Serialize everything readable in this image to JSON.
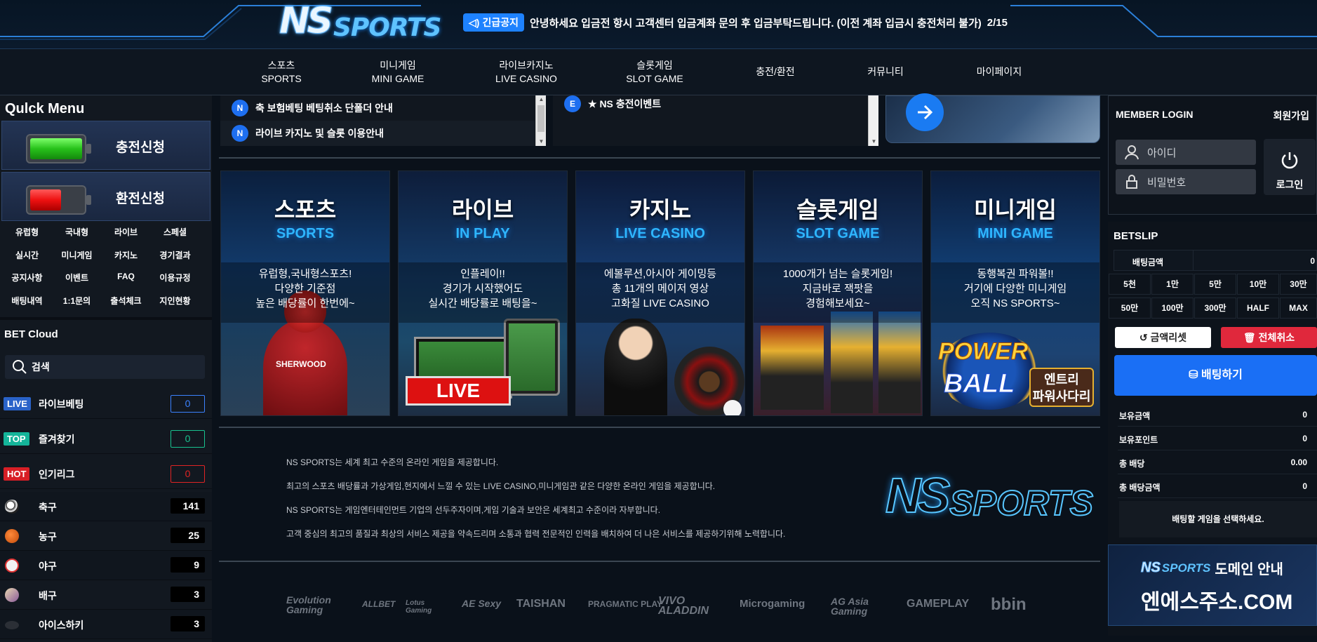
{
  "header": {
    "logo_ns": "NS",
    "logo_sports": "SPORTS",
    "notice_badge": "긴급공지",
    "notice_text": "안녕하세요 입금전 항시 고객센터 입금계좌 문의 후 입금부탁드립니다. (이전 계좌 입금시 충전처리 불가)",
    "notice_page": "2/15"
  },
  "nav": [
    {
      "kr": "스포츠",
      "en": "SPORTS"
    },
    {
      "kr": "미니게임",
      "en": "MINI GAME"
    },
    {
      "kr": "라이브카지노",
      "en": "LIVE CASINO"
    },
    {
      "kr": "슬롯게임",
      "en": "SLOT GAME"
    },
    {
      "kr": "충전/환전",
      "en": ""
    },
    {
      "kr": "커뮤니티",
      "en": ""
    },
    {
      "kr": "마이페이지",
      "en": ""
    }
  ],
  "quick_menu": {
    "title": "Qulck Menu",
    "charge": "충전신청",
    "exchange": "환전신청",
    "links": [
      "유럽형",
      "국내형",
      "라이브",
      "스페셜",
      "실시간",
      "미니게임",
      "카지노",
      "경기결과",
      "공지사항",
      "이벤트",
      "FAQ",
      "이용규정",
      "배팅내역",
      "1:1문의",
      "출석체크",
      "지인현황"
    ]
  },
  "bet_cloud": {
    "title": "BET Cloud",
    "search_placeholder": "검색",
    "tags": [
      {
        "tag": "LIVE",
        "label": "라이브베팅",
        "count": "0",
        "color": "#2a63c9",
        "count_color": "#3b82ff"
      },
      {
        "tag": "TOP",
        "label": "즐겨찾기",
        "count": "0",
        "color": "#15b59a",
        "count_color": "#19c28f"
      },
      {
        "tag": "HOT",
        "label": "인기리그",
        "count": "0",
        "color": "#d81f26",
        "count_color": "#e02424"
      }
    ],
    "sports": [
      {
        "name": "축구",
        "count": "141",
        "icon": "soccer-ball-icon"
      },
      {
        "name": "농구",
        "count": "25",
        "icon": "basketball-icon"
      },
      {
        "name": "야구",
        "count": "9",
        "icon": "baseball-icon"
      },
      {
        "name": "배구",
        "count": "3",
        "icon": "volleyball-icon"
      },
      {
        "name": "아이스하키",
        "count": "3",
        "icon": "hockey-puck-icon"
      }
    ]
  },
  "notices_left": [
    {
      "badge": "N",
      "text": "축 보험베팅 베팅취소 단폴더 안내"
    },
    {
      "badge": "N",
      "text": "라이브 카지노 및 슬롯 이용안내"
    }
  ],
  "notices_right": [
    {
      "badge": "E",
      "text": "★ NS 충전이벤트"
    }
  ],
  "cards": [
    {
      "kr": "스포츠",
      "en": "SPORTS",
      "desc": [
        "유럽형,국내형스포츠!",
        "다양한 기준점",
        "높은 배당률이 한번에~"
      ]
    },
    {
      "kr": "라이브",
      "en": "IN PLAY",
      "desc": [
        "인플레이!!",
        "경기가 시작했어도",
        "실시간 배당률로 배팅을~"
      ]
    },
    {
      "kr": "카지노",
      "en": "LIVE CASINO",
      "desc": [
        "에볼루션,아시아 게이밍등",
        "총 11개의 메이저 영상",
        "고화질 LIVE CASINO"
      ]
    },
    {
      "kr": "슬롯게임",
      "en": "SLOT GAME",
      "desc": [
        "1000개가 넘는 슬롯게임!",
        "지금바로 잭팟을",
        "경험해보세요~"
      ]
    },
    {
      "kr": "미니게임",
      "en": "MINI GAME",
      "desc": [
        "동행복권 파워볼!!",
        "거기에 다양한 미니게임",
        "오직 NS SPORTS~"
      ]
    }
  ],
  "card_extras": {
    "live_badge": "LIVE",
    "powerball_1": "POWER",
    "powerball_2": "BALL",
    "entry_1": "엔트리",
    "entry_2": "파워사다리",
    "jersey_text": "SHERWOOD"
  },
  "footer": {
    "lines": [
      "NS SPORTS는 세계 최고 수준의 온라인 게임을 제공합니다.",
      "최고의 스포츠 배당률과 가상게임,현지에서 느낄 수 있는 LIVE CASINO,미니게임관 같은 다양한 온라인 게임을 제공합니다.",
      "NS SPORTS는 게임엔터테인먼트 기업의 선두주자이며,게임 기술과 보안은 세계최고 수준이라 자부합니다.",
      "고객 중심의 최고의 품질과 최상의 서비스 제공을 약속드리며 소통과 협력 전문적인 인력을 배치하여 더 나은 서비스를 제공하기위해 노력합니다."
    ],
    "providers": [
      "Evolution Gaming",
      "ALLBET",
      "Lotus Gaming",
      "AE Sexy",
      "TAISHAN",
      "PRAGMATIC PLAY",
      "VIVO ALADDIN",
      "Microgaming",
      "AG Asia Gaming",
      "GAMEPLAY",
      "bbin"
    ]
  },
  "member": {
    "title": "MEMBER LOGIN",
    "join": "회원가입",
    "id_placeholder": "아이디",
    "pw_placeholder": "비밀번호",
    "login": "로그인"
  },
  "betslip": {
    "title": "BETSLIP",
    "amount_label": "배팅금액",
    "amount_value": "0",
    "chips_row1": [
      "5천",
      "1만",
      "5만",
      "10만",
      "30만"
    ],
    "chips_row2": [
      "50만",
      "100만",
      "300만",
      "HALF",
      "MAX"
    ],
    "reset": "금액리셋",
    "cancel_all": "전체취소",
    "bet": "배팅하기",
    "info": [
      {
        "k": "보유금액",
        "v": "0"
      },
      {
        "k": "보유포인트",
        "v": "0"
      },
      {
        "k": "총 배당",
        "v": "0.00"
      },
      {
        "k": "총 배당금액",
        "v": "0"
      }
    ],
    "select_msg": "배팅할 게임을 선택하세요."
  },
  "domain_banner": {
    "logo_ns": "NS",
    "logo_sports": "SPORTS",
    "guide": "도메인 안내",
    "domain": "엔에스주소.COM"
  }
}
